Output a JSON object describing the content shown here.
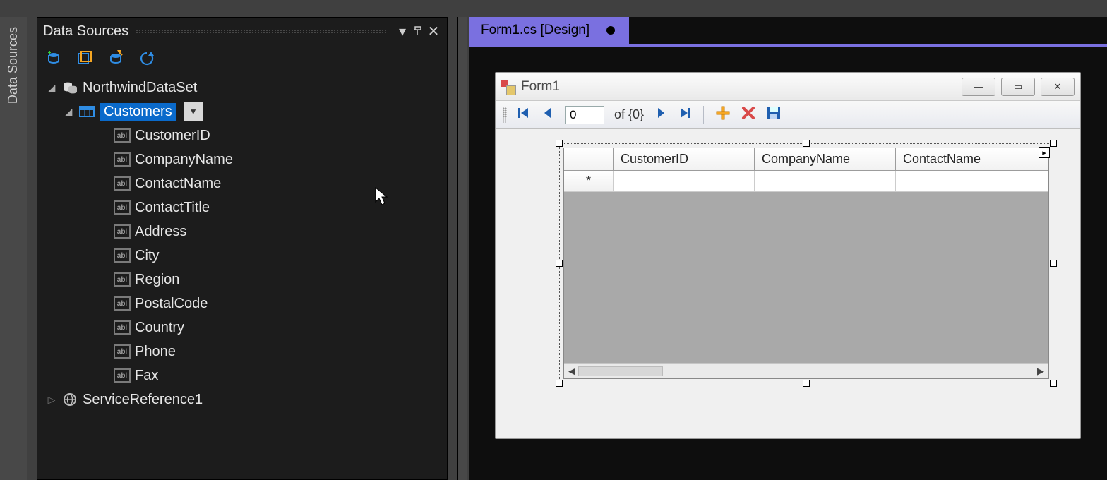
{
  "vertical_tab": {
    "label": "Data Sources"
  },
  "panel": {
    "title": "Data Sources",
    "toolbar": {
      "add_label": "Add New Data Source",
      "edit_label": "Edit DataSet",
      "configure_label": "Configure",
      "refresh_label": "Refresh"
    },
    "tree": {
      "root": "NorthwindDataSet",
      "selected_table": "Customers",
      "columns": [
        "CustomerID",
        "CompanyName",
        "ContactName",
        "ContactTitle",
        "Address",
        "City",
        "Region",
        "PostalCode",
        "Country",
        "Phone",
        "Fax"
      ],
      "service_ref": "ServiceReference1"
    }
  },
  "document": {
    "tab_label": "Form1.cs [Design]",
    "form_title": "Form1",
    "window_buttons": {
      "minimize": "—",
      "maximize": "▭",
      "close": "✕"
    },
    "navigator": {
      "position_value": "0",
      "of_text": "of {0}"
    },
    "grid": {
      "columns": [
        "CustomerID",
        "CompanyName",
        "ContactName"
      ],
      "new_row_glyph": "*"
    }
  }
}
